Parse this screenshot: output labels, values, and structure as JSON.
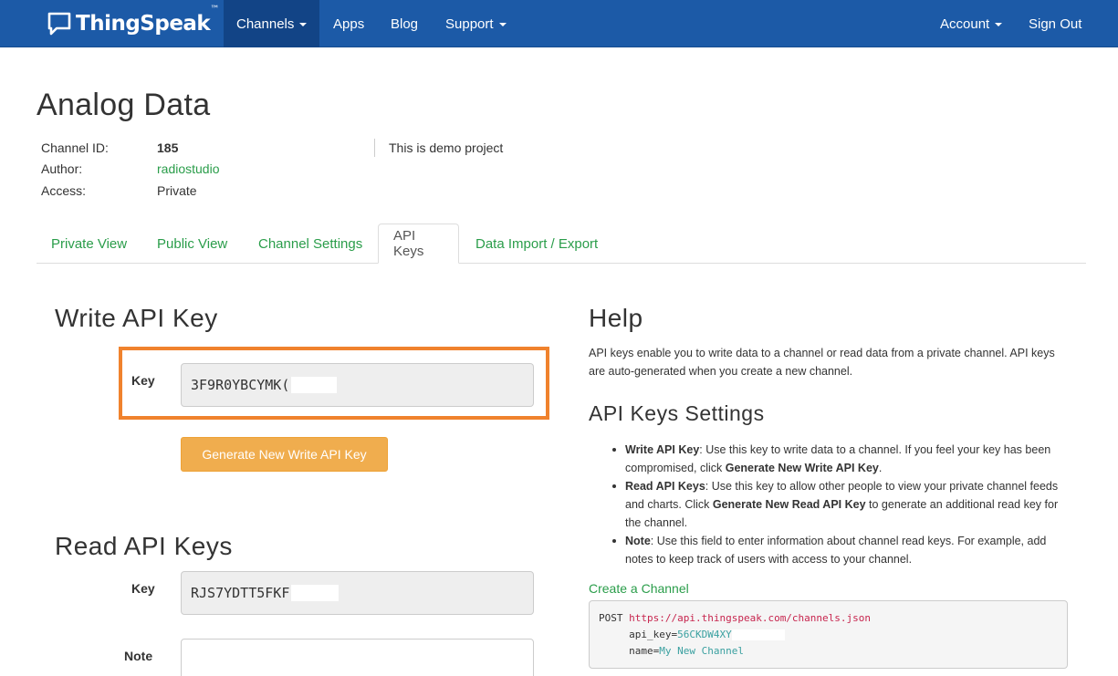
{
  "navbar": {
    "brand": "ThingSpeak",
    "brand_tm": "™",
    "brand_icon": "speech-bubble-icon",
    "items": [
      {
        "label": "Channels",
        "dropdown": true,
        "active": true
      },
      {
        "label": "Apps",
        "dropdown": false
      },
      {
        "label": "Blog",
        "dropdown": false
      },
      {
        "label": "Support",
        "dropdown": true
      }
    ],
    "right_items": [
      {
        "label": "Account",
        "dropdown": true
      },
      {
        "label": "Sign Out",
        "dropdown": false
      }
    ],
    "color": "#1c5aa7"
  },
  "channel": {
    "title": "Analog Data",
    "id_label": "Channel ID:",
    "id_value": "185",
    "author_label": "Author:",
    "author_value": "radiostudio",
    "access_label": "Access:",
    "access_value": "Private",
    "description": "This is demo project"
  },
  "tabs": [
    {
      "label": "Private View",
      "active": false
    },
    {
      "label": "Public View",
      "active": false
    },
    {
      "label": "Channel Settings",
      "active": false
    },
    {
      "label": "API Keys",
      "active": true
    },
    {
      "label": "Data Import / Export",
      "active": false
    }
  ],
  "write_key": {
    "title": "Write API Key",
    "key_label": "Key",
    "key_value": "3F9R0YBCYMK(",
    "button_label": "Generate New Write API Key",
    "highlight_color": "#f0822d"
  },
  "read_keys": {
    "title": "Read API Keys",
    "key_label": "Key",
    "key_value": "RJS7YDTT5FKF",
    "note_label": "Note",
    "note_value": ""
  },
  "help": {
    "title": "Help",
    "text": "API keys enable you to write data to a channel or read data from a private channel. API keys are auto-generated when you create a new channel.",
    "settings_title": "API Keys Settings",
    "bullets": [
      {
        "term": "Write API Key",
        "text_before": ": Use this key to write data to a channel. If you feel your key has been compromised, click ",
        "bold": "Generate New Write API Key",
        "text_after": "."
      },
      {
        "term": "Read API Keys",
        "text_before": ": Use this key to allow other people to view your private channel feeds and charts. Click ",
        "bold": "Generate New Read API Key",
        "text_after": " to generate an additional read key for the channel."
      },
      {
        "term": "Note",
        "text_before": ": Use this field to enter information about channel read keys. For example, add notes to keep track of users with access to your channel.",
        "bold": "",
        "text_after": ""
      }
    ],
    "create_link": "Create a Channel",
    "code": {
      "method": "POST",
      "url": "https://api.thingspeak.com/channels.json",
      "param1_name": "api_key=",
      "param1_value": "56CKDW4XY",
      "param2_name": "name=",
      "param2_value": "My New Channel"
    }
  }
}
